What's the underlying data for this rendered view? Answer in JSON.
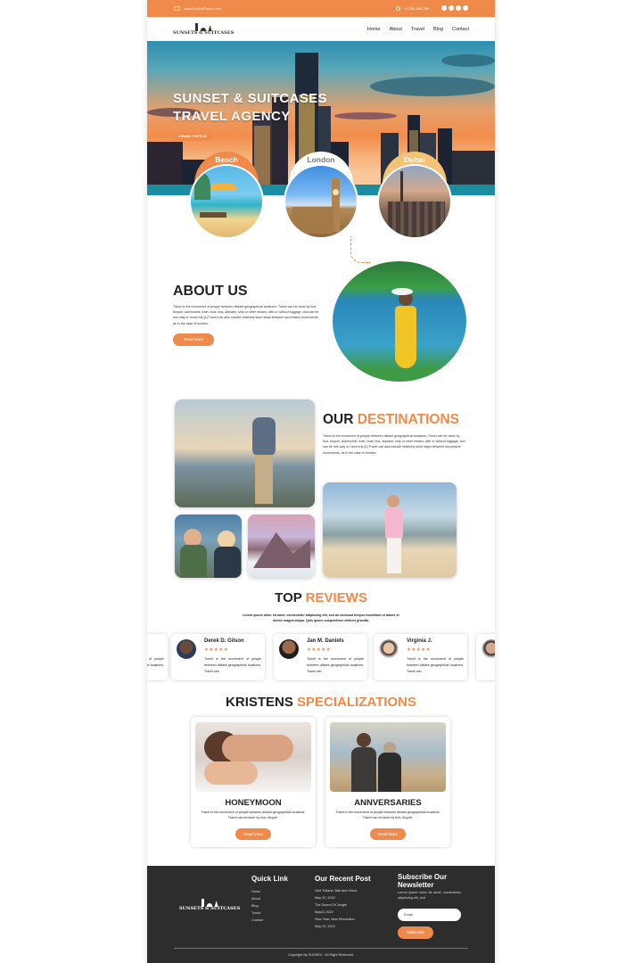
{
  "topbar": {
    "email": "www.SunSetTravel.com",
    "phone": "+1 234-456-789"
  },
  "brand": {
    "name": "SUNSETS & SUITCASES"
  },
  "nav": {
    "home": "Home",
    "about": "About",
    "travel": "Travel",
    "blog": "Blog",
    "contact": "Contact"
  },
  "hero": {
    "line1": "SUNSET & SUITCASES",
    "line2": "TRAVEL AGENCY",
    "button": "CONSULT WITH US"
  },
  "destinations": [
    {
      "label": "Beach"
    },
    {
      "label": "London"
    },
    {
      "label": "Dubai"
    }
  ],
  "about": {
    "title": "ABOUT US",
    "text": "Travel is the movement of people between distant geographical locations. Travel can be done by foot, bicycle, automobile, train, boat, bus, airplane, ship or other means, with or without luggage, and can be one way or round trip.[1] Travel can also include relatively short stays between successive movements, as in the case of tourism.",
    "button": "Read More"
  },
  "our_destinations": {
    "title_a": "OUR ",
    "title_b": "DESTINATIONS",
    "text": "Travel is the movement of people between distant geographical locations. Travel can be done by foot, bicycle, automobile, train, boat, bus, airplane, ship or other means, with or without luggage, and can be one way or round trip.[1] Travel can also include relatively short stays between successive movements, as in the case of tourism."
  },
  "reviews": {
    "title_a": "TOP ",
    "title_b": "REVIEWS",
    "subtitle": "Lorem ipsum dolor sit amet, consectetur adipiscing elit, sed do eiusmod tempor incididunt ut labore et dolore magna aliqua. Quis ipsum suspendisse ultrices gravida.",
    "stars": "★★★★★",
    "text": "Travel is the movement of people between distant geographical locations. Travel can",
    "items": [
      {
        "name": "Derek D. Gilson"
      },
      {
        "name": "Jan M. Daniels"
      },
      {
        "name": "Virginia J."
      }
    ]
  },
  "specializations": {
    "title_a": "KRISTENS ",
    "title_b": "SPECIALIZATIONS",
    "items": [
      {
        "title": "HONEYMOON",
        "text": "Travel is the movement of people between distant geographical locations. Travel can be done by foot, bicycle.",
        "button": "Read More"
      },
      {
        "title": "ANNVERSARIES",
        "text": "Travel is the movement of people between distant geographical locations. Travel can be done by foot, bicycle.",
        "button": "Read More"
      }
    ]
  },
  "footer": {
    "quick_title": "Quick Link",
    "quick": [
      "Home",
      "About",
      "Blog",
      "Travel",
      "Contact"
    ],
    "recent_title": "Our Recent Post",
    "recent": [
      "Visit Thiland, Bali and China",
      "May 22, 2022",
      "The Sound Of Jungle",
      "May22,2022",
      "New Year, New Resolution",
      "May 22, 2022"
    ],
    "news_title_1": "Subscribe Our",
    "news_title_2": "Newsletter",
    "news_text": "Lorem ipsum dolor sit amet, consectetur adipiscing elit, sed",
    "email_placeholder": "Email",
    "subscribe": "Subscribe",
    "copyright": "Copyright By SUNSEX . All Right Reserved."
  },
  "colors": {
    "accent": "#f08a4b",
    "footer_bg": "#2d2d2d"
  }
}
